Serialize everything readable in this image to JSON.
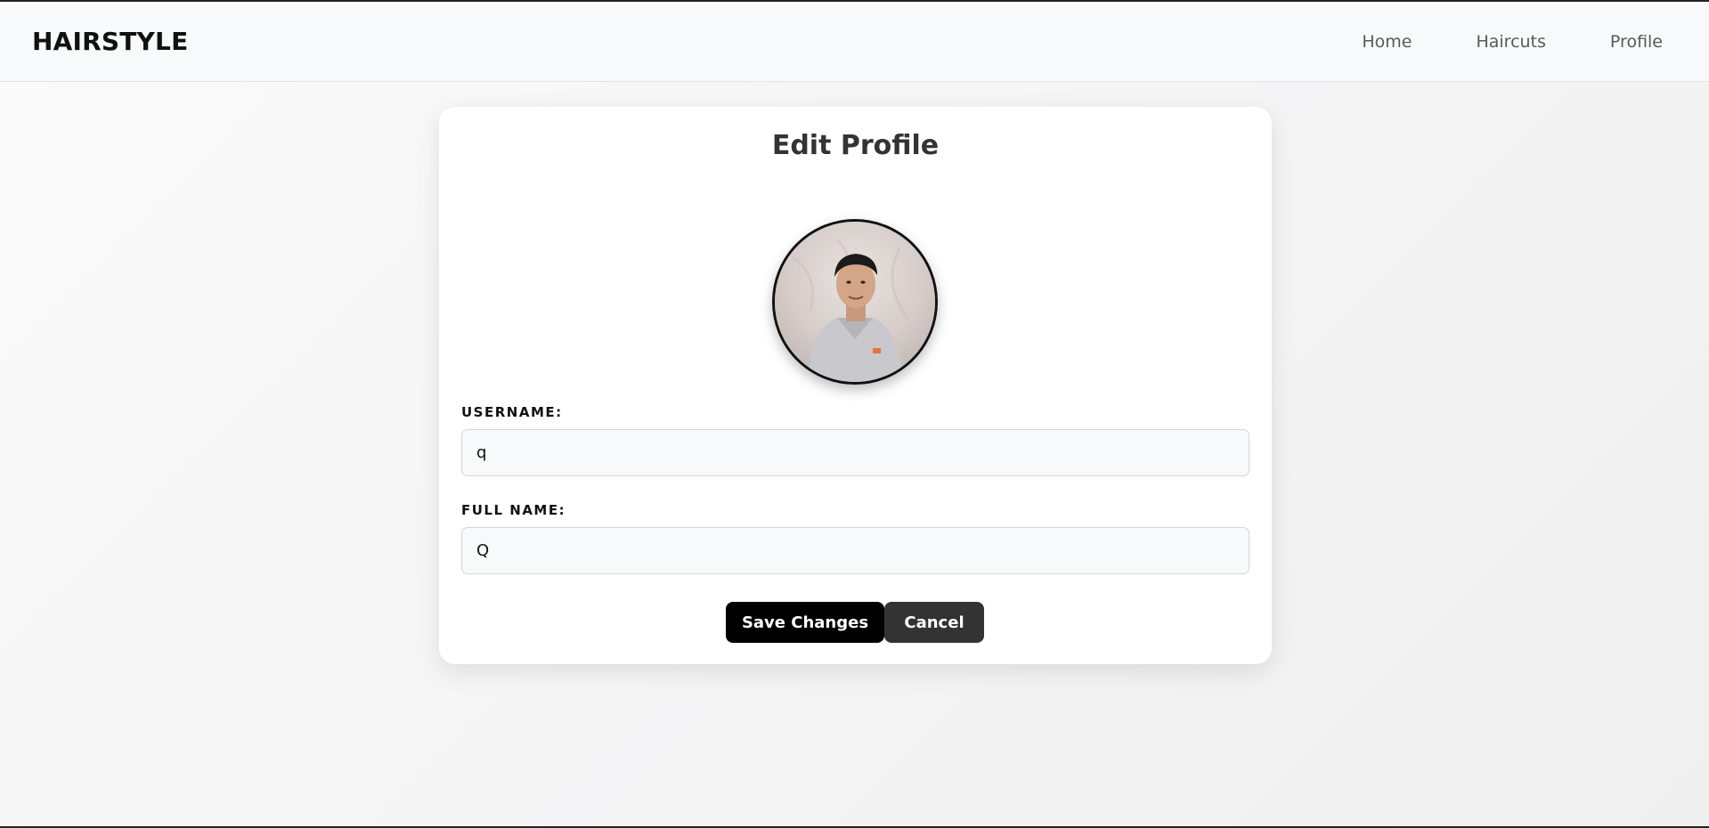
{
  "navbar": {
    "brand": "HAIRSTYLE",
    "links": [
      {
        "label": "Home"
      },
      {
        "label": "Haircuts"
      },
      {
        "label": "Profile"
      }
    ]
  },
  "card": {
    "title": "Edit Profile",
    "avatar": "profile-photo",
    "fields": {
      "username": {
        "label": "USERNAME:",
        "value": "q"
      },
      "fullname": {
        "label": "FULL NAME:",
        "value": "Q"
      }
    },
    "buttons": {
      "save_label": "Save Changes",
      "cancel_label": "Cancel"
    }
  },
  "colors": {
    "primary_button": "#000000",
    "secondary_button": "#333333",
    "navbar_bg": "#f8f9fa"
  }
}
